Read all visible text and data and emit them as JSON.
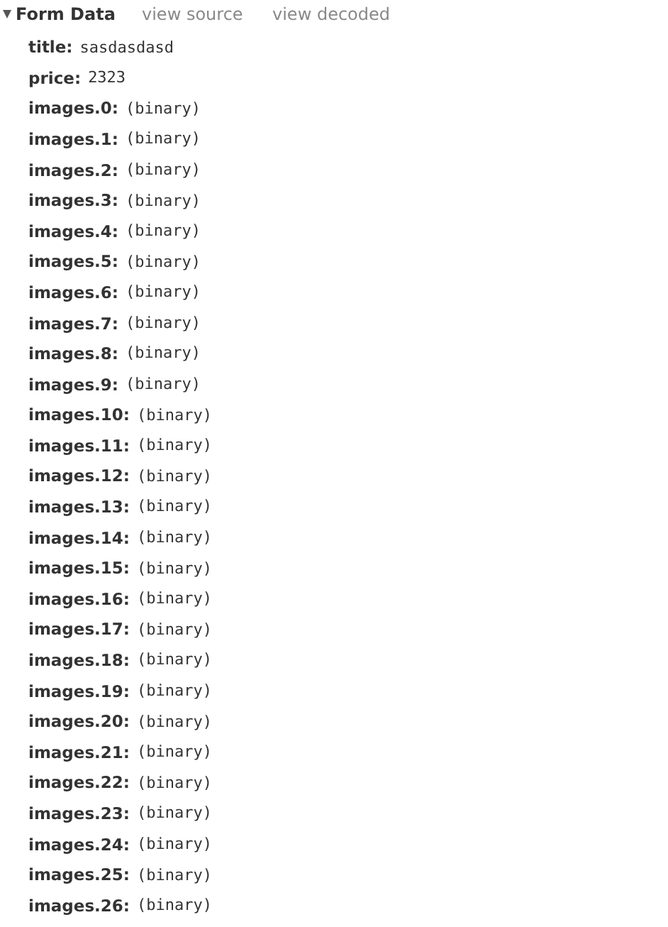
{
  "section": {
    "title": "Form Data",
    "expanded": true,
    "links": [
      "view source",
      "view decoded"
    ]
  },
  "fields": [
    {
      "key": "title:",
      "value": "sasdasdasd"
    },
    {
      "key": "price:",
      "value": "2323"
    },
    {
      "key": "images.0:",
      "value": "(binary)"
    },
    {
      "key": "images.1:",
      "value": "(binary)"
    },
    {
      "key": "images.2:",
      "value": "(binary)"
    },
    {
      "key": "images.3:",
      "value": "(binary)"
    },
    {
      "key": "images.4:",
      "value": "(binary)"
    },
    {
      "key": "images.5:",
      "value": "(binary)"
    },
    {
      "key": "images.6:",
      "value": "(binary)"
    },
    {
      "key": "images.7:",
      "value": "(binary)"
    },
    {
      "key": "images.8:",
      "value": "(binary)"
    },
    {
      "key": "images.9:",
      "value": "(binary)"
    },
    {
      "key": "images.10:",
      "value": "(binary)"
    },
    {
      "key": "images.11:",
      "value": "(binary)"
    },
    {
      "key": "images.12:",
      "value": "(binary)"
    },
    {
      "key": "images.13:",
      "value": "(binary)"
    },
    {
      "key": "images.14:",
      "value": "(binary)"
    },
    {
      "key": "images.15:",
      "value": "(binary)"
    },
    {
      "key": "images.16:",
      "value": "(binary)"
    },
    {
      "key": "images.17:",
      "value": "(binary)"
    },
    {
      "key": "images.18:",
      "value": "(binary)"
    },
    {
      "key": "images.19:",
      "value": "(binary)"
    },
    {
      "key": "images.20:",
      "value": "(binary)"
    },
    {
      "key": "images.21:",
      "value": "(binary)"
    },
    {
      "key": "images.22:",
      "value": "(binary)"
    },
    {
      "key": "images.23:",
      "value": "(binary)"
    },
    {
      "key": "images.24:",
      "value": "(binary)"
    },
    {
      "key": "images.25:",
      "value": "(binary)"
    },
    {
      "key": "images.26:",
      "value": "(binary)"
    }
  ]
}
